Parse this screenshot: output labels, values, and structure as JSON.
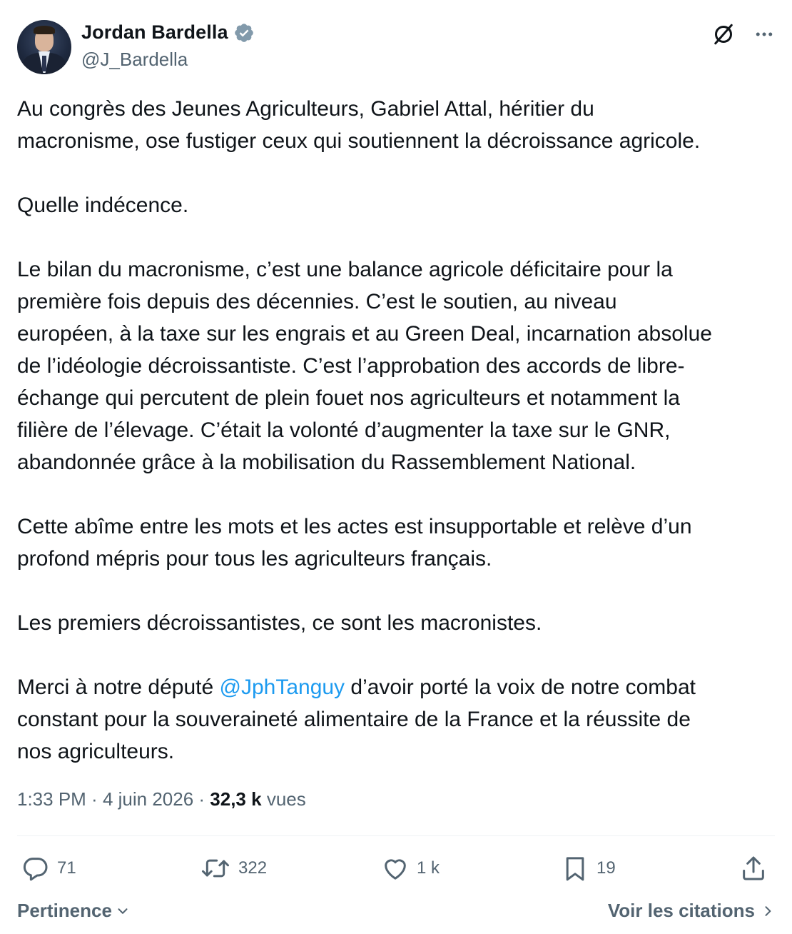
{
  "author": {
    "name": "Jordan Bardella",
    "handle": "@J_Bardella",
    "verified": true
  },
  "tweet": {
    "lines_p1": [
      "Au congrès des Jeunes Agriculteurs, Gabriel Attal, héritier du",
      "macronisme, ose fustiger ceux qui soutiennent la décroissance agricole."
    ],
    "p2": "Quelle indécence.",
    "lines_p3": [
      "Le bilan du macronisme, c’est une balance agricole déficitaire pour la",
      "première fois depuis des décennies. C’est le soutien, au niveau",
      "européen, à la taxe sur les engrais et au Green Deal, incarnation absolue",
      "de l’idéologie décroissantiste. C’est l’approbation des accords de libre-",
      "échange qui percutent de plein fouet nos agriculteurs et notamment la",
      "filière de l’élevage. C’était la volonté d’augmenter la taxe sur le GNR,",
      "abandonnée grâce à la mobilisation du Rassemblement National."
    ],
    "lines_p4": [
      "Cette abîme entre les mots et les actes est insupportable et relève d’un",
      "profond mépris pour tous les agriculteurs français."
    ],
    "p5": "Les premiers décroissantistes, ce sont les macronistes.",
    "p6_line1_before": "Merci à notre député ",
    "p6_mention": "@JphTanguy",
    "p6_line1_after": " d’avoir porté la voix de notre combat",
    "p6_line2": "constant pour la souveraineté alimentaire de la France et la réussite de",
    "p6_line3": "nos agriculteurs."
  },
  "meta": {
    "time": "1:33 PM",
    "sep": " · ",
    "date": "4 juin 2026",
    "views_count": "32,3 k",
    "views_label": "vues"
  },
  "actions": {
    "replies": "71",
    "reposts": "322",
    "likes": "1 k",
    "bookmarks": "19"
  },
  "footer": {
    "sort_label": "Pertinence",
    "quotes_label": "Voir les citations"
  },
  "colors": {
    "text": "#0f1419",
    "secondary": "#536471",
    "link": "#1d9bf0",
    "verified": "#829aab",
    "divider": "#eff3f4"
  },
  "icons": {
    "verified": "verified-badge-icon",
    "grok": "grok-icon",
    "more": "more-icon",
    "reply": "reply-icon",
    "repost": "repost-icon",
    "like": "heart-icon",
    "bookmark": "bookmark-icon",
    "share": "share-icon",
    "chevron_down": "chevron-down-icon",
    "chevron_right": "chevron-right-icon"
  }
}
